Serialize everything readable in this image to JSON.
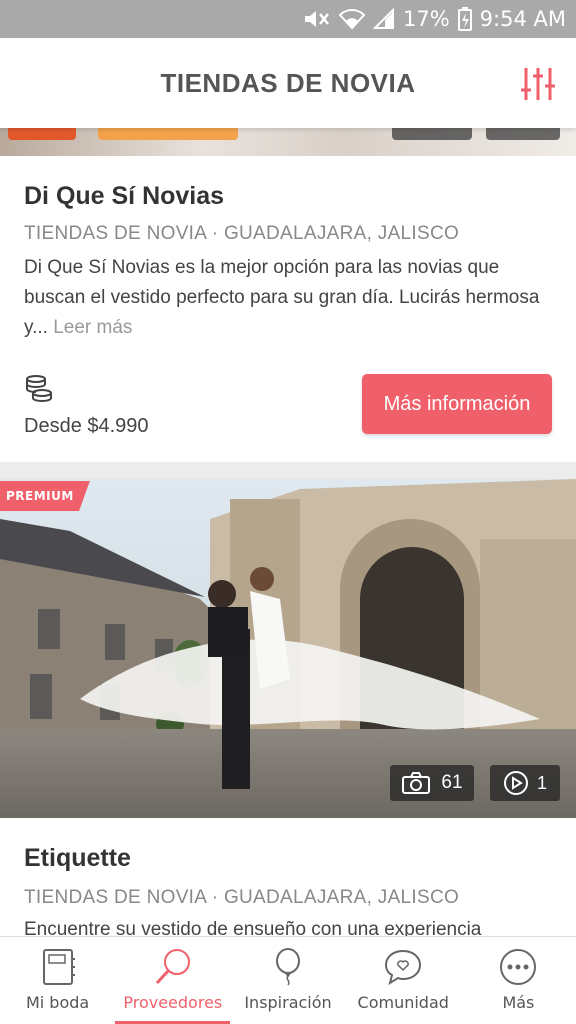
{
  "status_bar": {
    "battery": "17%",
    "time": "9:54 AM"
  },
  "header": {
    "title": "TIENDAS DE NOVIA"
  },
  "listing1": {
    "name": "Di Que Sí Novias",
    "meta": "TIENDAS DE NOVIA · GUADALAJARA, JALISCO",
    "description": "Di Que Sí Novias es la mejor opción para las novias que buscan el vestido perfecto para su gran día. Lucirás hermosa y...",
    "read_more": "Leer más",
    "price": "Desde $4.990",
    "cta_label": "Más información"
  },
  "listing2": {
    "badge": "PREMIUM",
    "photo_count": "61",
    "video_count": "1",
    "name": "Etiquette",
    "meta": "TIENDAS DE NOVIA · GUADALAJARA, JALISCO",
    "description": "Encuentre su vestido de ensueño con una experiencia"
  },
  "bottom_nav": {
    "items": [
      {
        "label": "Mi boda",
        "icon": "notebook-icon"
      },
      {
        "label": "Proveedores",
        "icon": "magnifier-icon"
      },
      {
        "label": "Inspiración",
        "icon": "balloon-icon"
      },
      {
        "label": "Comunidad",
        "icon": "chat-heart-icon"
      },
      {
        "label": "Más",
        "icon": "more-dots-icon"
      }
    ],
    "active": "Proveedores"
  },
  "colors": {
    "accent": "#f0606a",
    "status_bar": "#a9a9a9",
    "text_dark": "#333333",
    "text_muted": "#888888"
  }
}
